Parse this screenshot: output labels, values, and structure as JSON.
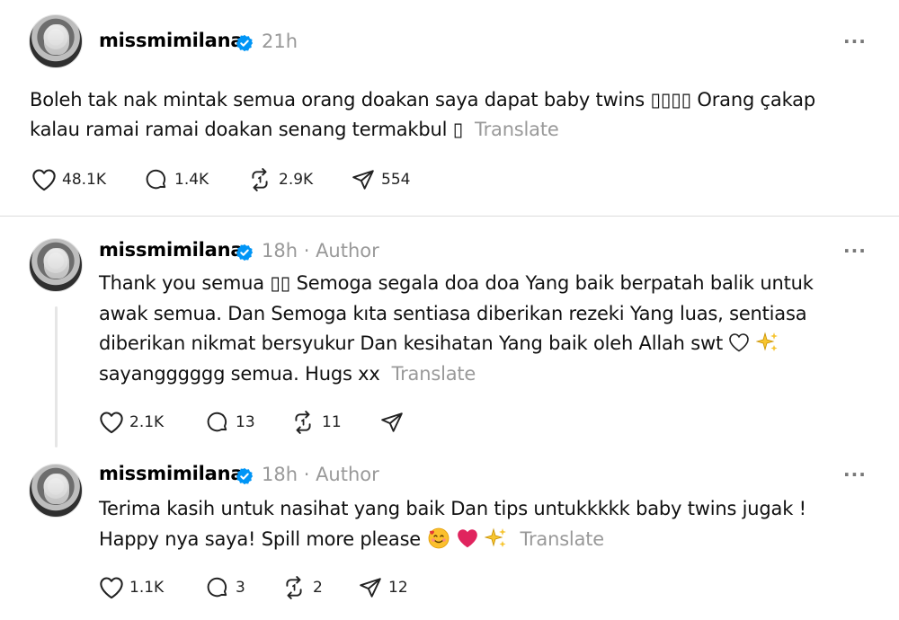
{
  "posts": [
    {
      "username": "missmimilana",
      "time": "21h",
      "author_tag": "",
      "text_line1": "Boleh tak nak mintak semua orang doakan saya dapat baby twins ▯▯▯▯ Orang çakap",
      "text_line2": "kalau ramai ramai doakan senang termakbul ▯",
      "translate": "Translate",
      "likes": "48.1K",
      "replies": "1.4K",
      "reposts": "2.9K",
      "shares": "554"
    },
    {
      "username": "missmimilana",
      "time": "18h",
      "author_tag": "· Author",
      "text_line1": "Thank you semua ▯▯ Semoga segala doa doa Yang baik berpatah balik untuk",
      "text_line2": "awak semua. Dan Semoga kıta sentiasa diberikan rezeki Yang luas, sentiasa",
      "text_line3": "diberikan nikmat bersyukur Dan kesihatan Yang baik oleh Allah swt",
      "text_line4": "sayangggggg semua. Hugs xx",
      "translate": "Translate",
      "likes": "2.1K",
      "replies": "13",
      "reposts": "11",
      "shares": ""
    },
    {
      "username": "missmimilana",
      "time": "18h",
      "author_tag": "· Author",
      "text_line1": "Terima kasih untuk nasihat yang baik Dan tips untukkkkk baby twins jugak !",
      "text_line2": "Happy nya saya! Spill more please",
      "translate": "Translate",
      "likes": "1.1K",
      "replies": "3",
      "reposts": "2",
      "shares": "12"
    }
  ],
  "icons": {
    "like": "heart-icon",
    "reply": "comment-icon",
    "repost": "repost-icon",
    "share": "send-icon",
    "more": "more-icon",
    "verified": "verified-badge-icon"
  },
  "colors": {
    "verified": "#0095f6",
    "muted": "#999999",
    "text": "#101010",
    "heart_red": "#e0245e"
  }
}
